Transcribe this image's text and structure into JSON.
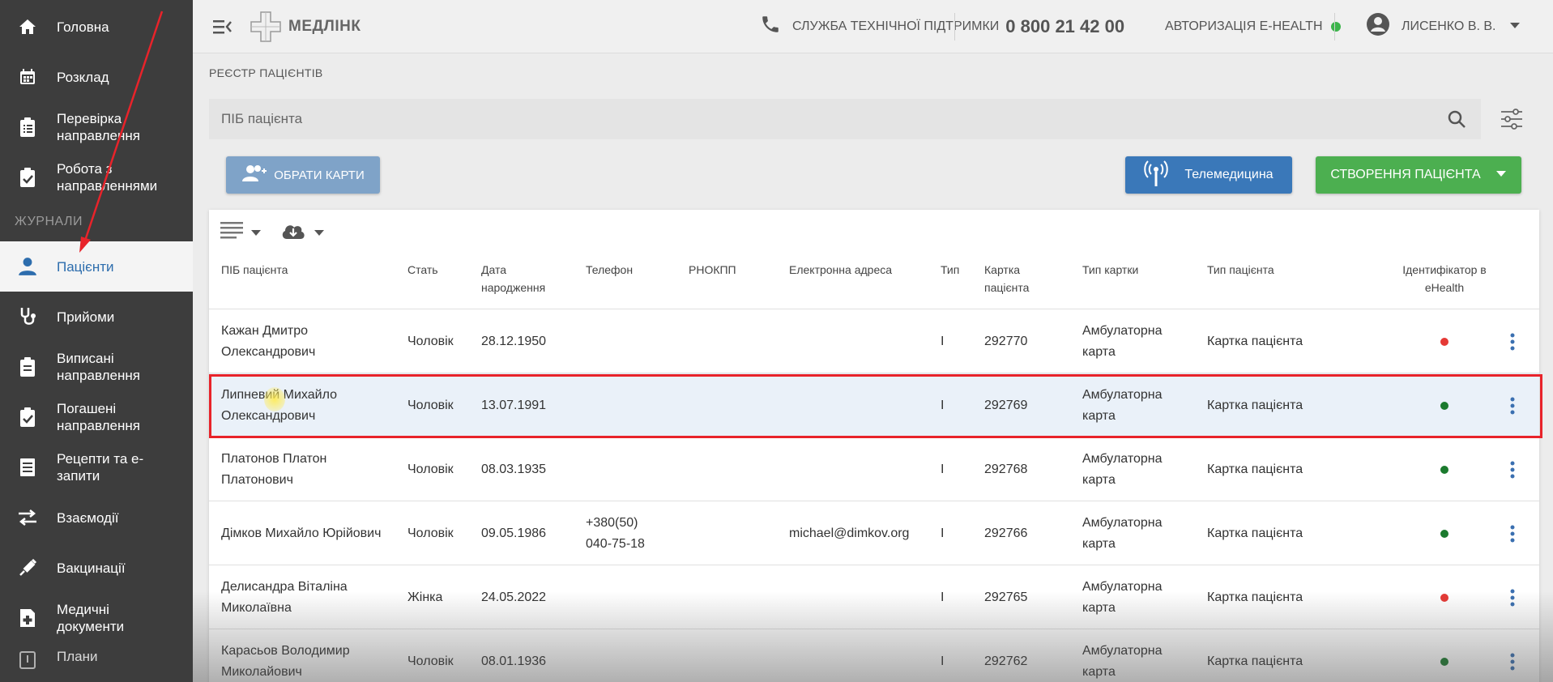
{
  "sidebar": {
    "items": [
      {
        "label": "Головна",
        "icon": "home-icon"
      },
      {
        "label": "Розклад",
        "icon": "calendar-icon"
      },
      {
        "label": "Перевірка направлення",
        "icon": "clipboard-list-icon"
      },
      {
        "label": "Робота з направленнями",
        "icon": "clipboard-check-icon"
      }
    ],
    "section_label": "ЖУРНАЛИ",
    "journal_items": [
      {
        "label": "Пацієнти",
        "icon": "person-icon",
        "active": true
      },
      {
        "label": "Прийоми",
        "icon": "stethoscope-icon"
      },
      {
        "label": "Виписані направлення",
        "icon": "clipboard-list-icon"
      },
      {
        "label": "Погашені направлення",
        "icon": "clipboard-check-icon"
      },
      {
        "label": "Рецепти та е-запити",
        "icon": "document-icon"
      },
      {
        "label": "Взаємодії",
        "icon": "swap-arrows-icon"
      },
      {
        "label": "Вакцинації",
        "icon": "syringe-icon"
      },
      {
        "label": "Медичні документи",
        "icon": "medical-document-icon"
      },
      {
        "label": "Плани",
        "icon": "plan-icon"
      }
    ]
  },
  "header": {
    "logo_text": "МЕДЛІНК",
    "support_label": "СЛУЖБА ТЕХНІЧНОЇ ПІДТРИМКИ",
    "support_phone": "0 800 21 42 00",
    "ehealth_label": "АВТОРИЗАЦІЯ E-HEALTH",
    "ehealth_status_color": "#3cb44b",
    "user_name": "ЛИСЕНКО В. В."
  },
  "main": {
    "breadcrumb": "РЕЄСТР ПАЦІЄНТІВ",
    "search_placeholder": "ПІБ пацієнта",
    "select_cards_label": "ОБРАТИ КАРТИ",
    "telemedicine_label": "Телемедицина",
    "create_patient_label": "СТВОРЕННЯ ПАЦІЄНТА"
  },
  "table": {
    "columns": [
      "ПІБ пацієнта",
      "Стать",
      "Дата народження",
      "Телефон",
      "РНОКПП",
      "Електронна адреса",
      "Тип",
      "Картка пацієнта",
      "Тип картки",
      "Тип пацієнта",
      "Ідентифікатор в eHealth"
    ],
    "rows": [
      {
        "name": "Кажан Дмитро Олександрович",
        "sex": "Чоловік",
        "dob": "28.12.1950",
        "phone": "",
        "rnokpp": "",
        "email": "",
        "type": "I",
        "card": "292770",
        "card_type": "Амбулаторна карта",
        "patient_type": "Картка пацієнта",
        "ehealth_color": "#e53935",
        "selected": false
      },
      {
        "name": "Липневий Михайло Олександрович",
        "sex": "Чоловік",
        "dob": "13.07.1991",
        "phone": "",
        "rnokpp": "",
        "email": "",
        "type": "I",
        "card": "292769",
        "card_type": "Амбулаторна карта",
        "patient_type": "Картка пацієнта",
        "ehealth_color": "#1b7a2e",
        "selected": true
      },
      {
        "name": "Платонов Платон Платонович",
        "sex": "Чоловік",
        "dob": "08.03.1935",
        "phone": "",
        "rnokpp": "",
        "email": "",
        "type": "I",
        "card": "292768",
        "card_type": "Амбулаторна карта",
        "patient_type": "Картка пацієнта",
        "ehealth_color": "#1b7a2e",
        "selected": false
      },
      {
        "name": "Дімков Михайло Юрійович",
        "sex": "Чоловік",
        "dob": "09.05.1986",
        "phone": "+380(50) 040-75-18",
        "rnokpp": "",
        "email": "michael@dimkov.org",
        "type": "I",
        "card": "292766",
        "card_type": "Амбулаторна карта",
        "patient_type": "Картка пацієнта",
        "ehealth_color": "#1b7a2e",
        "selected": false
      },
      {
        "name": "Делисандра Віталіна Миколаївна",
        "sex": "Жінка",
        "dob": "24.05.2022",
        "phone": "",
        "rnokpp": "",
        "email": "",
        "type": "I",
        "card": "292765",
        "card_type": "Амбулаторна карта",
        "patient_type": "Картка пацієнта",
        "ehealth_color": "#e53935",
        "selected": false
      },
      {
        "name": "Карасьов Володимир Миколайович",
        "sex": "Чоловік",
        "dob": "08.01.1936",
        "phone": "",
        "rnokpp": "",
        "email": "",
        "type": "I",
        "card": "292762",
        "card_type": "Амбулаторна карта",
        "patient_type": "Картка пацієнта",
        "ehealth_color": "#1b7a2e",
        "selected": false
      }
    ]
  }
}
